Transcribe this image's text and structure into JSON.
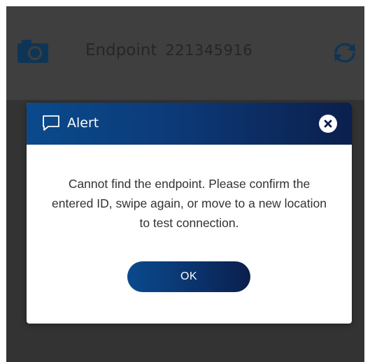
{
  "header": {
    "endpoint_label": "Endpoint",
    "endpoint_id": "221345916",
    "icon_camera": "camera-icon",
    "icon_refresh": "refresh-icon"
  },
  "alert": {
    "title": "Alert",
    "message": "Cannot find the endpoint. Please confirm the entered ID, swipe again, or move to a new location to test connection.",
    "ok_label": "OK",
    "icon_title": "chat-bubble-icon",
    "icon_close": "close-icon"
  },
  "colors": {
    "accent_blue": "#0a4a8c",
    "accent_navy": "#0b1f4d",
    "overlay": "#3b3b3b",
    "header_icon_blue": "#0f3556"
  }
}
